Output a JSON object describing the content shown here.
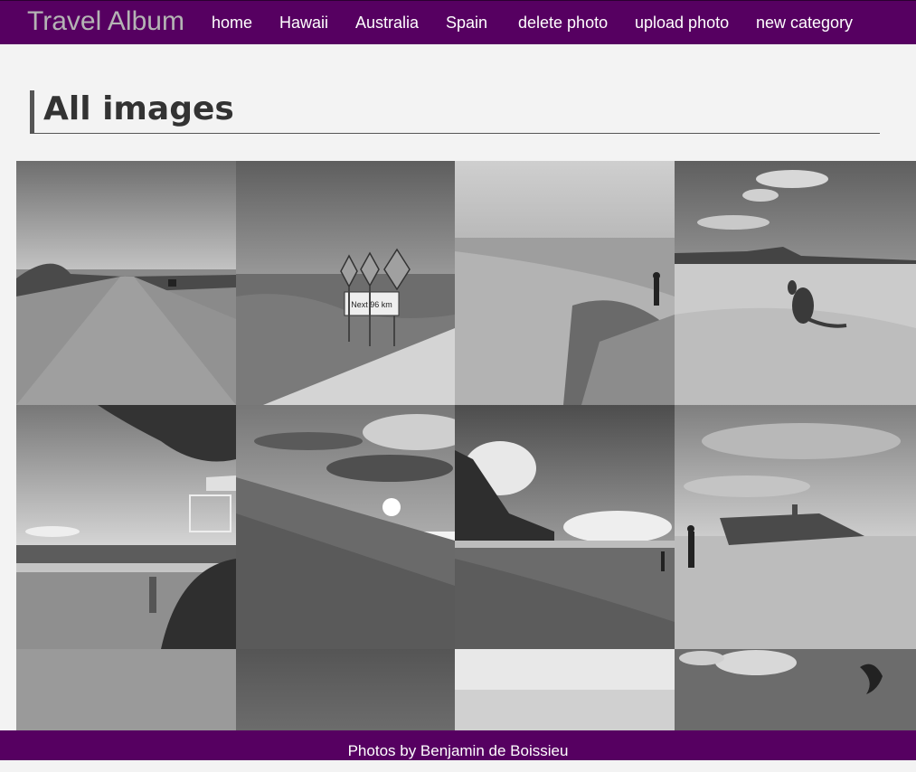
{
  "navbar": {
    "brand": "Travel Album",
    "links": [
      {
        "label": "home"
      },
      {
        "label": "Hawaii"
      },
      {
        "label": "Australia"
      },
      {
        "label": "Spain"
      },
      {
        "label": "delete photo"
      },
      {
        "label": "upload photo"
      },
      {
        "label": "new category"
      }
    ],
    "background_color": "#560061"
  },
  "main": {
    "title": "All images"
  },
  "gallery": {
    "photos": [
      {
        "subject": "desert-road"
      },
      {
        "subject": "wildlife-warning-signs",
        "sign_text": "Next 96 km"
      },
      {
        "subject": "rocky-cliff-hiker"
      },
      {
        "subject": "kangaroo-on-beach"
      },
      {
        "subject": "beach-lifeguard-tower"
      },
      {
        "subject": "sunset-over-sand"
      },
      {
        "subject": "palm-beach"
      },
      {
        "subject": "shipwreck-on-beach"
      },
      {
        "subject": "grey-sky"
      },
      {
        "subject": "dark-sky"
      },
      {
        "subject": "horizon-sea"
      },
      {
        "subject": "kitesurf-beach"
      }
    ]
  },
  "footer": {
    "text": "Photos by Benjamin de Boissieu"
  }
}
